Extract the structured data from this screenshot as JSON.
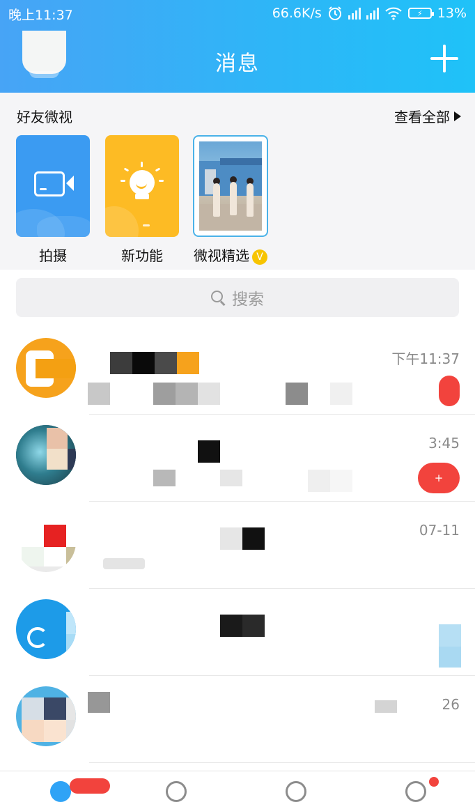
{
  "status_bar": {
    "time": "晚上11:37",
    "network_speed": "66.6K/s",
    "battery_level": "13%",
    "icons": [
      "alarm-clock-icon",
      "signal-icon",
      "signal-icon",
      "wifi-icon",
      "battery-charging-icon"
    ]
  },
  "header": {
    "title": "消息",
    "add_button_icon": "plus-icon"
  },
  "friends_video": {
    "title": "好友微视",
    "view_all": "查看全部",
    "tiles": [
      {
        "label": "拍摄",
        "icon": "video-camera-icon",
        "color": "#3b9bf2"
      },
      {
        "label": "新功能",
        "icon": "lightbulb-icon",
        "color": "#fdbb24"
      },
      {
        "label": "微视精选",
        "badge": "V",
        "icon": "photo-thumbnail"
      }
    ]
  },
  "search": {
    "placeholder": "搜索",
    "icon": "search-icon"
  },
  "conversations": [
    {
      "time": "下午11:37",
      "has_unread": true,
      "unread_count": ""
    },
    {
      "time": "3:45",
      "has_unread": true,
      "unread_count": "+"
    },
    {
      "time": "07-11",
      "has_unread": false
    },
    {
      "time": "",
      "has_unread": false
    },
    {
      "time": "26",
      "has_unread": false
    }
  ],
  "colors": {
    "header_gradient_start": "#47a4f6",
    "header_gradient_end": "#1fc2f8",
    "badge_red": "#f2433d",
    "vip_yellow": "#f7c400"
  }
}
